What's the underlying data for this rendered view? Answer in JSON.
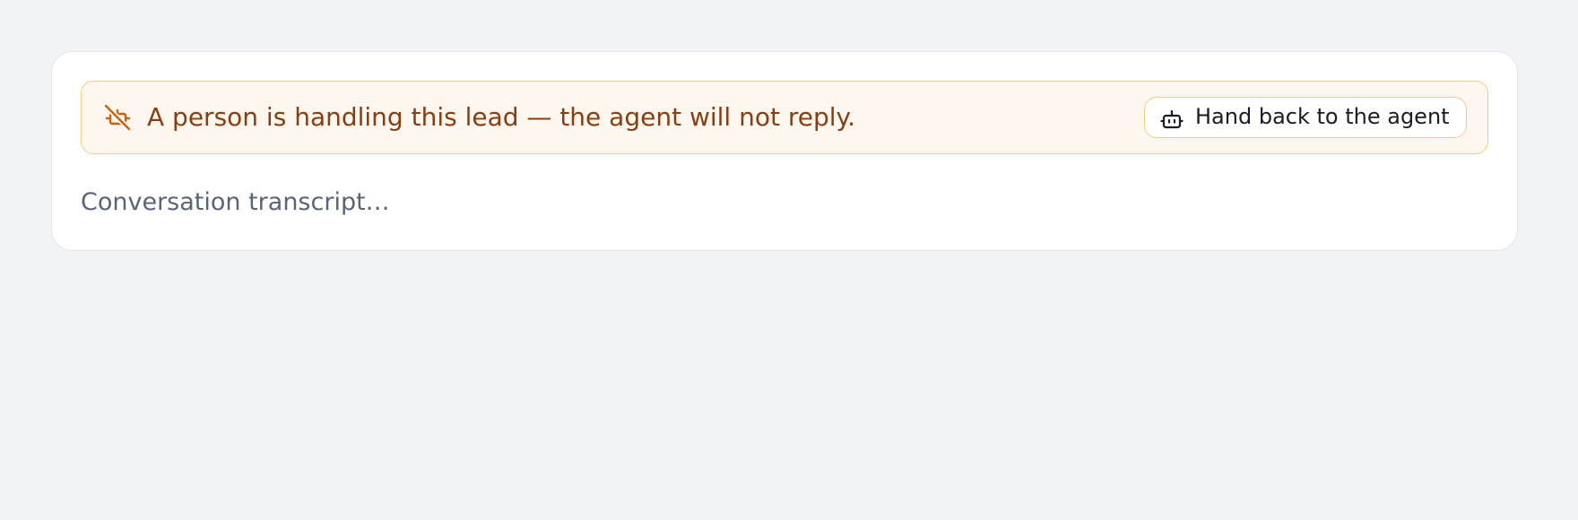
{
  "banner": {
    "icon": "bot-off-icon",
    "message": "A person is handling this lead — the agent will not reply.",
    "accent_color": "#c8620f",
    "text_color": "#8c3d0e",
    "background_color": "#fdf7f0",
    "border_color": "#f3cf7b"
  },
  "handback_button": {
    "icon": "bot-icon",
    "label": "Hand back to the agent"
  },
  "transcript": {
    "placeholder": "Conversation transcript…"
  }
}
